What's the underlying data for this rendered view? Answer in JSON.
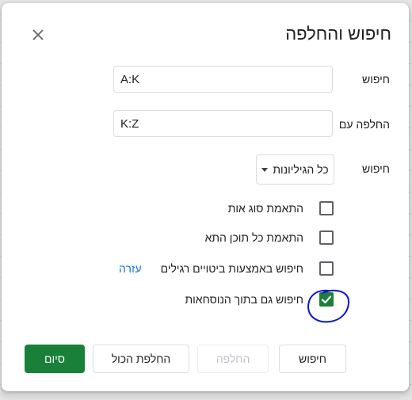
{
  "dialog": {
    "title": "חיפוש והחלפה",
    "close_icon": "close-icon"
  },
  "find": {
    "label": "חיפוש",
    "value": "A:K"
  },
  "replace": {
    "label": "החלפה עם",
    "value": "K:Z"
  },
  "scope": {
    "label": "חיפוש",
    "selected": "כל הגיליונות",
    "icon": "caret-down-icon"
  },
  "options": {
    "match_case": {
      "label": "התאמת סוג אות",
      "checked": false
    },
    "match_entire": {
      "label": "התאמת כל תוכן התא",
      "checked": false
    },
    "regex": {
      "label": "חיפוש באמצעות ביטויים רגילים",
      "checked": false,
      "help": "עזרה"
    },
    "formulas": {
      "label": "חיפוש גם בתוך הנוסחאות",
      "checked": true
    }
  },
  "annotation": {
    "color": "#0a17c8"
  },
  "buttons": {
    "find": "חיפוש",
    "replace": "החלפה",
    "replace_all": "החלפת הכול",
    "done": "סיום"
  },
  "colors": {
    "primary": "#188038",
    "link": "#1a73e8"
  }
}
